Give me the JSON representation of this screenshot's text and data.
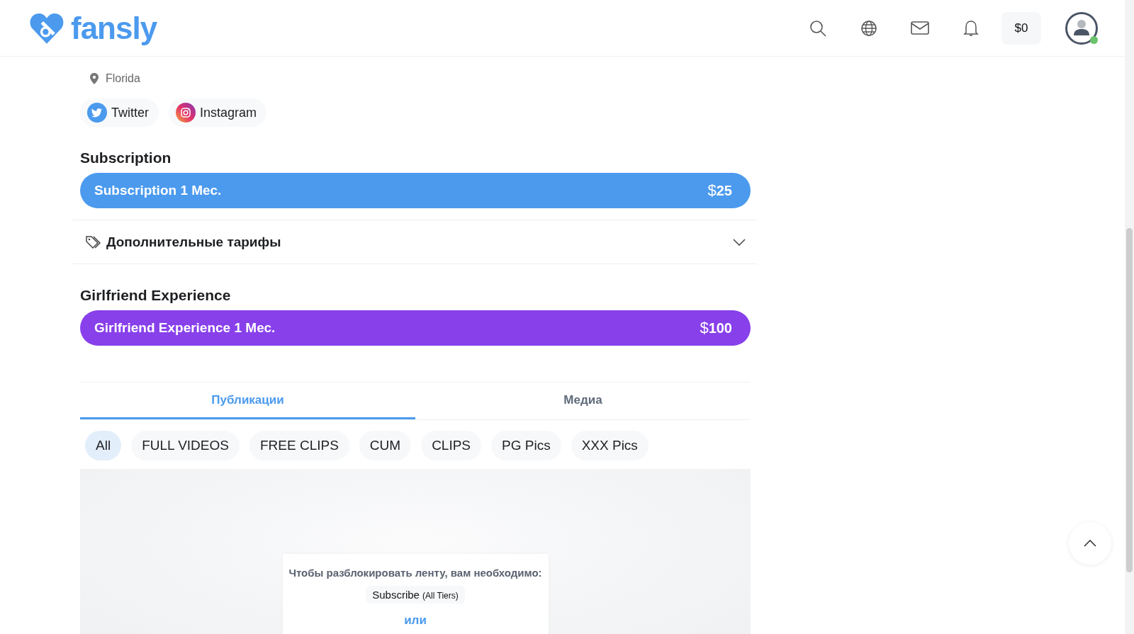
{
  "header": {
    "logo_text": "fansly",
    "balance": "$0",
    "avatar": {
      "online": true
    }
  },
  "profile": {
    "location": "Florida",
    "socials": [
      {
        "kind": "twitter",
        "label": "Twitter"
      },
      {
        "kind": "instagram",
        "label": "Instagram"
      }
    ]
  },
  "plans": [
    {
      "title": "Subscription",
      "plan_label": "Subscription 1 Мес.",
      "currency": "$",
      "amount": "25",
      "color": "#4b9aee"
    },
    {
      "title": "Girlfriend Experience",
      "plan_label": "Girlfriend Experience 1 Мес.",
      "currency": "$",
      "amount": "100",
      "color": "#8840ea"
    }
  ],
  "extra_tariffs": {
    "label": "Дополнительные тарифы",
    "expanded": false
  },
  "tabs": [
    {
      "label": "Публикации",
      "selected": true
    },
    {
      "label": "Медиа",
      "selected": false
    }
  ],
  "filters": [
    {
      "label": "All",
      "selected": true
    },
    {
      "label": "FULL VIDEOS",
      "selected": false
    },
    {
      "label": "FREE CLIPS",
      "selected": false
    },
    {
      "label": "CUM",
      "selected": false
    },
    {
      "label": "CLIPS",
      "selected": false
    },
    {
      "label": "PG Pics",
      "selected": false
    },
    {
      "label": "XXX Pics",
      "selected": false
    }
  ],
  "locked_feed": {
    "message": "Чтобы разблокировать ленту, вам необходимо:",
    "subscribe_label": "Subscribe",
    "subscribe_note": "(All Tiers)",
    "or_text": "или"
  }
}
